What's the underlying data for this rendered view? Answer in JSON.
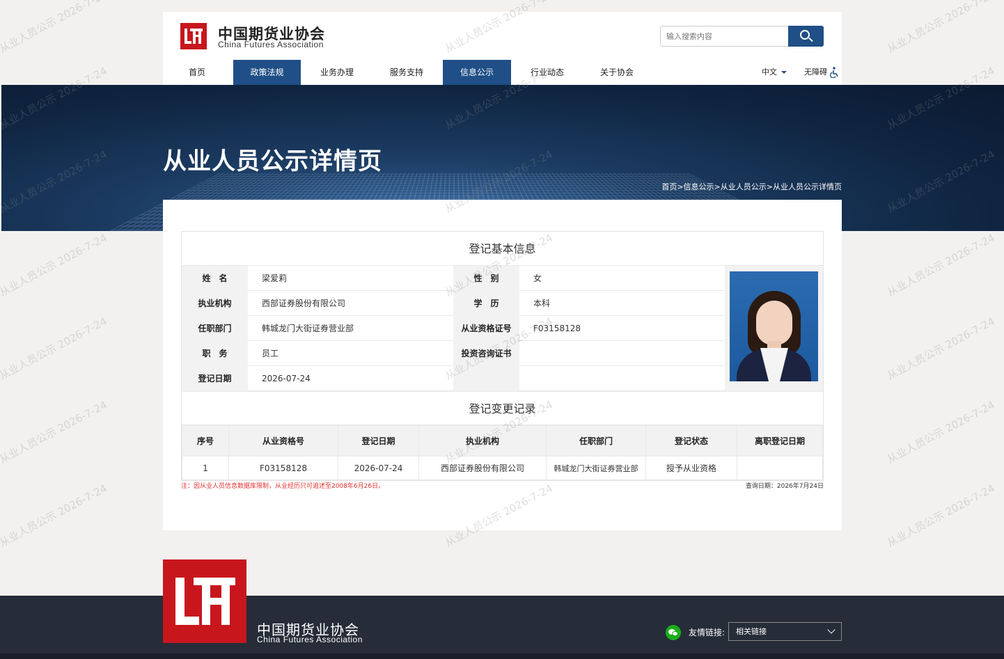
{
  "header": {
    "logo_cn": "中国期货业协会",
    "logo_en": "China Futures Association",
    "search_placeholder": "输入搜索内容"
  },
  "nav": {
    "items": [
      {
        "label": "首页",
        "active": false
      },
      {
        "label": "政策法规",
        "active": true
      },
      {
        "label": "业务办理",
        "active": false
      },
      {
        "label": "服务支持",
        "active": false
      },
      {
        "label": "信息公示",
        "active": true
      },
      {
        "label": "行业动态",
        "active": false
      },
      {
        "label": "关于协会",
        "active": false
      }
    ],
    "language": "中文",
    "accessibility": "无障碍"
  },
  "banner": {
    "title": "从业人员公示详情页",
    "breadcrumb": "首页>信息公示>从业人员公示>从业人员公示详情页"
  },
  "basic_info": {
    "title": "登记基本信息",
    "rows": [
      {
        "label1": "姓　名",
        "value1": "梁爱莉",
        "label2": "性　别",
        "value2": "女"
      },
      {
        "label1": "执业机构",
        "value1": "西部证券股份有限公司",
        "label2": "学　历",
        "value2": "本科"
      },
      {
        "label1": "任职部门",
        "value1": "韩城龙门大街证券营业部",
        "label2": "从业资格证号",
        "value2": "F03158128"
      },
      {
        "label1": "职　务",
        "value1": "员工",
        "label2": "投资咨询证书",
        "value2": ""
      },
      {
        "label1": "登记日期",
        "value1": "2026-07-24",
        "label2": "",
        "value2": ""
      }
    ]
  },
  "change_records": {
    "title": "登记变更记录",
    "headers": [
      "序号",
      "从业资格号",
      "登记日期",
      "执业机构",
      "任职部门",
      "登记状态",
      "离职登记日期"
    ],
    "rows": [
      [
        "1",
        "F03158128",
        "2026-07-24",
        "西部证券股份有限公司",
        "韩城龙门大街证券营业部",
        "授予从业资格",
        ""
      ]
    ]
  },
  "note": "注：因从业人员信息数据库限制，从业经历只可追述至2008年6月26日。",
  "query_date": "查询日期：2026年7月24日",
  "footer": {
    "logo_cn": "中国期货业协会",
    "logo_en": "China Futures Association",
    "links_label": "友情链接:",
    "links_selected": "相关链接"
  },
  "watermark": "从业人员公示 2026-7-24",
  "colors": {
    "brand_red": "#c8161d",
    "nav_blue": "#1f4f86",
    "footer_bg": "#262c38",
    "note_red": "#e0322f"
  }
}
